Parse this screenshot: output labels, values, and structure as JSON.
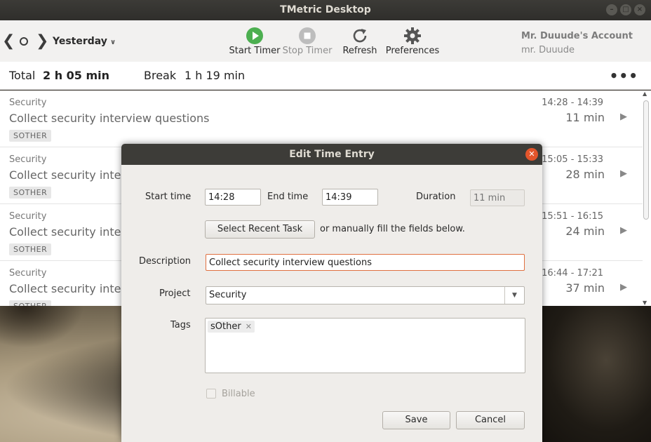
{
  "window": {
    "title": "TMetric Desktop"
  },
  "toolbar": {
    "day": "Yesterday",
    "start_timer": "Start Timer",
    "stop_timer": "Stop Timer",
    "refresh": "Refresh",
    "preferences": "Preferences",
    "account_name": "Mr. Duuude's Account",
    "account_user": "mr. Duuude"
  },
  "totals": {
    "total_label": "Total",
    "total_value": "2 h 05 min",
    "break_label": "Break",
    "break_value": "1 h 19 min",
    "more": "•••"
  },
  "entries": [
    {
      "project": "Security",
      "description": "Collect security interview questions",
      "tag": "SOTHER",
      "range": "14:28 - 14:39",
      "duration": "11 min"
    },
    {
      "project": "Security",
      "description": "Collect security interview questions",
      "tag": "SOTHER",
      "range": "15:05 - 15:33",
      "duration": "28 min"
    },
    {
      "project": "Security",
      "description": "Collect security interview questions",
      "tag": "SOTHER",
      "range": "15:51 - 16:15",
      "duration": "24 min"
    },
    {
      "project": "Security",
      "description": "Collect security interview questions",
      "tag": "SOTHER",
      "range": "16:44 - 17:21",
      "duration": "37 min"
    }
  ],
  "dialog": {
    "title": "Edit Time Entry",
    "start_label": "Start time",
    "start_value": "14:28",
    "end_label": "End time",
    "end_value": "14:39",
    "duration_label": "Duration",
    "duration_placeholder": "11 min",
    "recent_task": "Select Recent Task",
    "manual_hint": "or manually fill the fields below.",
    "description_label": "Description",
    "description_value": "Collect security interview questions",
    "project_label": "Project",
    "project_value": "Security",
    "tags_label": "Tags",
    "tag_value": "sOther",
    "billable_label": "Billable",
    "save": "Save",
    "cancel": "Cancel"
  },
  "colors": {
    "start_green": "#4caf50",
    "close_orange": "#e3552b",
    "focus_border": "#e07040"
  },
  "icons": [
    "chevron-left-icon",
    "today-circle-icon",
    "chevron-right-icon",
    "play-icon",
    "stop-icon",
    "refresh-icon",
    "gear-icon",
    "more-icon",
    "close-icon"
  ]
}
